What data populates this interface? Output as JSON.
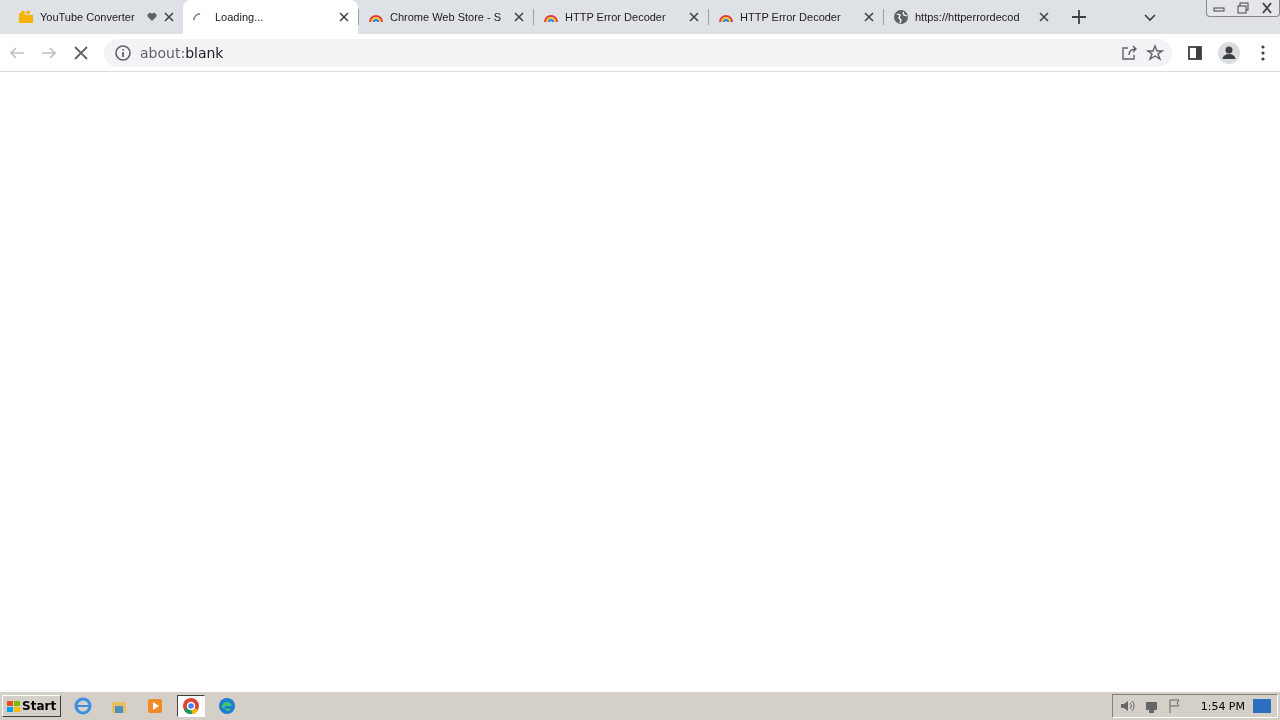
{
  "tabs": [
    {
      "title": "YouTube Converter",
      "kind": "folder",
      "heart": true,
      "selected": false
    },
    {
      "title": "Loading...",
      "kind": "spinner",
      "heart": false,
      "selected": true
    },
    {
      "title": "Chrome Web Store - S",
      "kind": "rainbow",
      "heart": false,
      "selected": false
    },
    {
      "title": "HTTP Error Decoder",
      "kind": "rainbow",
      "heart": false,
      "selected": false
    },
    {
      "title": "HTTP Error Decoder",
      "kind": "rainbow",
      "heart": false,
      "selected": false
    },
    {
      "title": "https://httperrordecod",
      "kind": "globe",
      "heart": false,
      "selected": false
    }
  ],
  "address_bar": {
    "scheme": "about:",
    "value": "blank"
  },
  "taskbar": {
    "start": "Start",
    "apps": [
      {
        "kind": "ie",
        "selected": false
      },
      {
        "kind": "explorer",
        "selected": false
      },
      {
        "kind": "media",
        "selected": false
      },
      {
        "kind": "chrome",
        "selected": true
      },
      {
        "kind": "edge",
        "selected": false
      }
    ],
    "clock": "1:54 PM"
  }
}
